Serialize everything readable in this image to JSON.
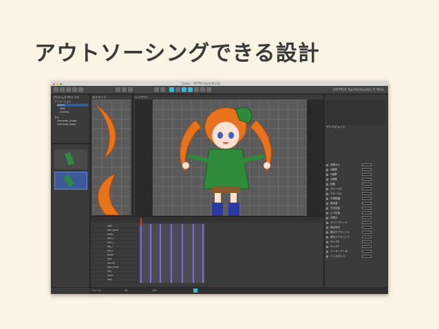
{
  "slide": {
    "title": "アウトソーシングできる設計"
  },
  "app": {
    "window_title": "Game – OPTPiX SpriteStudio",
    "brand": "OPTPiX SpriteStudio 5 Nile",
    "colors": {
      "accent": "#39b8d9",
      "selection": "#2f5f9a",
      "key": "#7d6ed9"
    }
  },
  "project_panel": {
    "tabs": [
      "プロジェクト",
      "ファイル"
    ],
    "items": [
      "アニメーション",
      "player",
      "walk",
      "running",
      "セル",
      "character_sheet",
      "character_body"
    ]
  },
  "cellmap_panel": {
    "title": "セルマップ"
  },
  "layout_panel": {
    "title": "レイアウト"
  },
  "timeline_panel": {
    "parts": [
      "root",
      "hair_back",
      "body",
      "arm_l",
      "arm_r",
      "leg_l",
      "leg_r",
      "head",
      "eye",
      "mouth",
      "hair_front",
      "hat",
      "hand",
      "foot"
    ]
  },
  "inspector": {
    "title": "アトリビュート",
    "rows": [
      "参照セル",
      "X座標",
      "Y座標",
      "Z座標",
      "回転",
      "スケールX",
      "スケールY",
      "不透明度",
      "優先度",
      "左右反転",
      "上下反転",
      "非表示",
      "カラーブレンド",
      "頂点変形",
      "原点オフセットX",
      "原点オフセットY",
      "サイズX",
      "サイズY",
      "ユーザーデータ",
      "インスタンス"
    ]
  },
  "status": {
    "frame_label": "フレーム",
    "fps": "30",
    "end_frame": "120"
  }
}
